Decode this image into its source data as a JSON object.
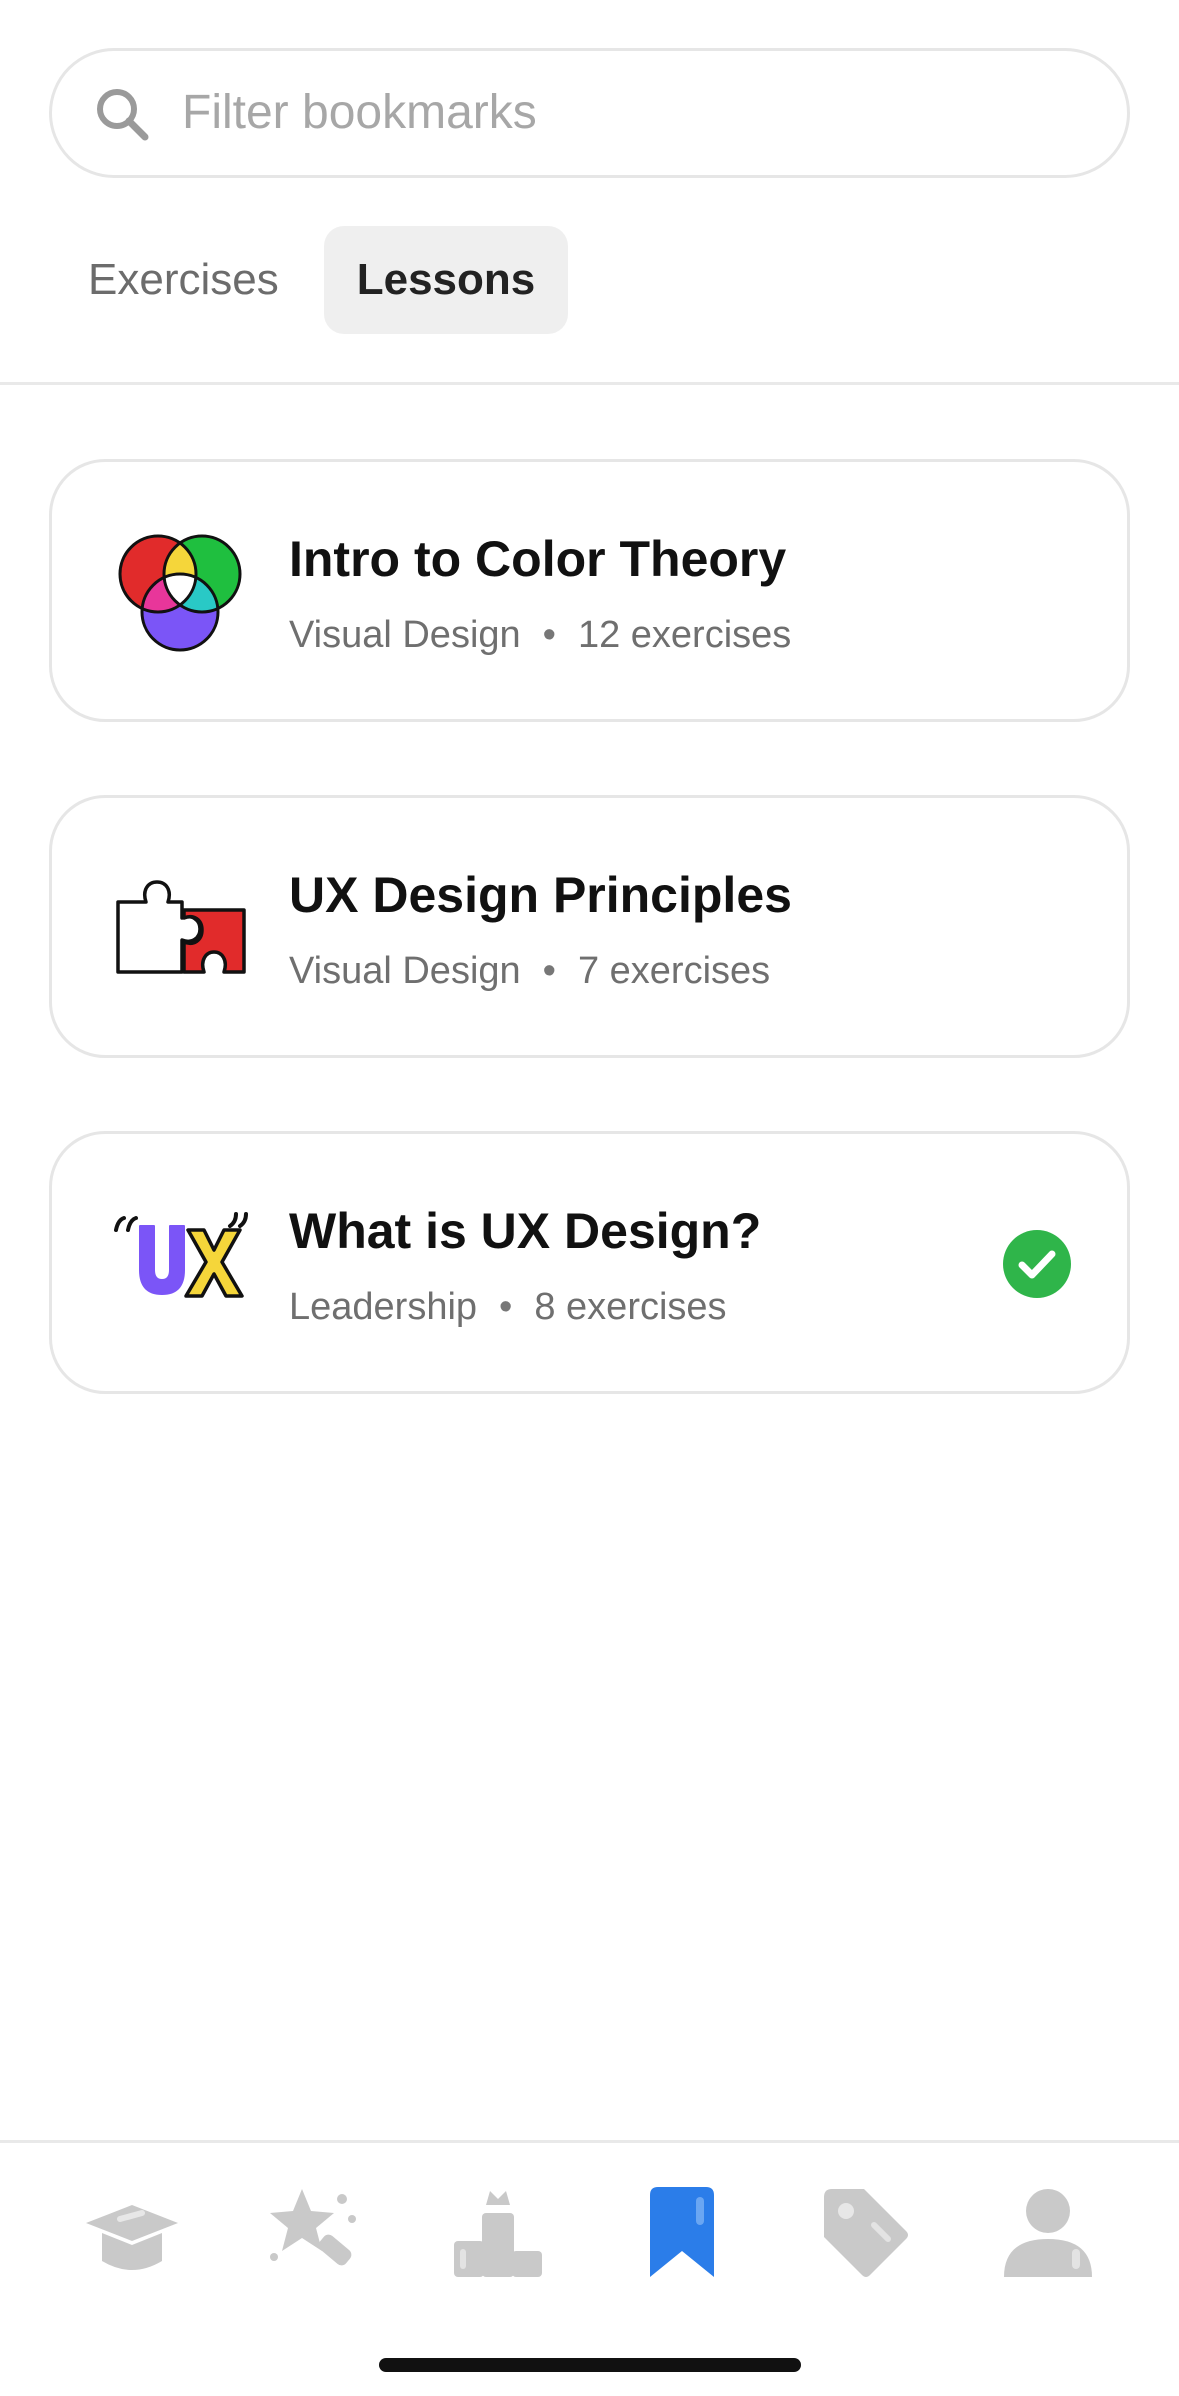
{
  "search": {
    "placeholder": "Filter bookmarks",
    "icon": "search-icon"
  },
  "tabs": [
    {
      "label": "Exercises",
      "selected": false
    },
    {
      "label": "Lessons",
      "selected": true
    }
  ],
  "lessons": [
    {
      "title": "Intro to Color Theory",
      "category": "Visual Design",
      "count": "12 exercises",
      "icon": "color-wheel-icon",
      "completed": false
    },
    {
      "title": "UX Design Principles",
      "category": "Visual Design",
      "count": "7 exercises",
      "icon": "puzzle-icon",
      "completed": false
    },
    {
      "title": "What is UX Design?",
      "category": "Leadership",
      "count": "8 exercises",
      "icon": "ux-quote-icon",
      "completed": true
    }
  ],
  "meta_separator": "•",
  "nav": [
    {
      "name": "learn",
      "icon": "graduation-cap-icon",
      "active": false
    },
    {
      "name": "practice",
      "icon": "star-wand-icon",
      "active": false
    },
    {
      "name": "leaderboard",
      "icon": "podium-icon",
      "active": false
    },
    {
      "name": "bookmarks",
      "icon": "bookmark-icon",
      "active": true
    },
    {
      "name": "deals",
      "icon": "tag-icon",
      "active": false
    },
    {
      "name": "profile",
      "icon": "person-icon",
      "active": false
    }
  ],
  "colors": {
    "accent": "#2b7de9",
    "inactive_icon": "#c9c9c9",
    "success": "#2fb54a"
  }
}
